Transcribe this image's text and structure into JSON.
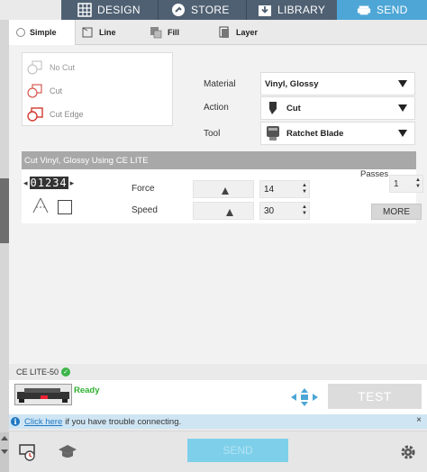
{
  "nav": {
    "tabs": [
      {
        "label": "DESIGN",
        "icon": "grid-icon"
      },
      {
        "label": "STORE",
        "icon": "store-icon"
      },
      {
        "label": "LIBRARY",
        "icon": "library-icon"
      },
      {
        "label": "SEND",
        "icon": "cutter-icon",
        "active": true
      }
    ]
  },
  "modes": {
    "tabs": [
      {
        "label": "Simple",
        "active": true
      },
      {
        "label": "Line"
      },
      {
        "label": "Fill"
      },
      {
        "label": "Layer"
      }
    ]
  },
  "cut_options": [
    {
      "label": "No Cut"
    },
    {
      "label": "Cut"
    },
    {
      "label": "Cut Edge"
    }
  ],
  "material": {
    "material_label": "Material",
    "material_value": "Vinyl, Glossy",
    "action_label": "Action",
    "action_value": "Cut",
    "tool_label": "Tool",
    "tool_value": "Ratchet Blade"
  },
  "cut_settings": {
    "title": "Cut Vinyl, Glossy Using CE LITE",
    "counter_digits": "01234",
    "force_label": "Force",
    "force_value": "14",
    "speed_label": "Speed",
    "speed_value": "30",
    "passes_label": "Passes",
    "passes_value": "1",
    "more_label": "MORE"
  },
  "device": {
    "name": "CE LITE-50",
    "status": "Ready",
    "test_label": "TEST"
  },
  "info": {
    "link_text": "Click here",
    "message": "if you have trouble connecting.",
    "close": "×"
  },
  "footer": {
    "send_label": "SEND"
  },
  "colors": {
    "nav_bg": "#4f6072",
    "nav_active": "#4da6d6",
    "ready": "#2db02d",
    "info_bg": "#cfe5f3",
    "send_bg": "#7ed0ea",
    "cut_red": "#d23a2f"
  }
}
